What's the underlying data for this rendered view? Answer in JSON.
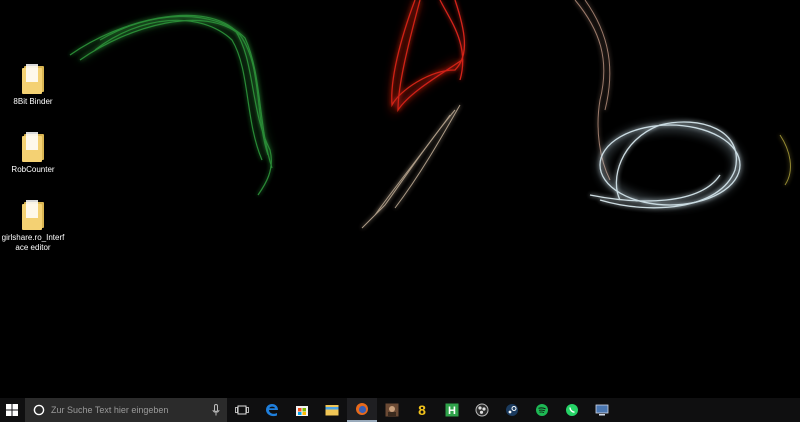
{
  "desktop": {
    "icons": [
      {
        "label": "8Bit Binder",
        "icon": "folder-icon"
      },
      {
        "label": "RobCounter",
        "icon": "folder-icon"
      },
      {
        "label": "girlshare.ro_Interface editor",
        "icon": "folder-icon"
      }
    ]
  },
  "taskbar": {
    "search_placeholder": "Zur Suche Text hier eingeben",
    "apps": [
      {
        "name": "task-view-icon"
      },
      {
        "name": "edge-icon"
      },
      {
        "name": "store-icon"
      },
      {
        "name": "file-explorer-icon"
      },
      {
        "name": "firefox-icon"
      },
      {
        "name": "game-app-icon"
      },
      {
        "name": "app-8-icon"
      },
      {
        "name": "app-h-icon"
      },
      {
        "name": "obs-icon"
      },
      {
        "name": "steam-icon"
      },
      {
        "name": "spotify-icon"
      },
      {
        "name": "whatsapp-icon"
      },
      {
        "name": "remote-desktop-icon"
      }
    ]
  },
  "colors": {
    "taskbar": "#0f0f10",
    "search_box": "#2b2b2b",
    "wallpaper_green": "#2f9a3c",
    "wallpaper_red": "#e0261a",
    "wallpaper_white": "#d8e8ee"
  }
}
